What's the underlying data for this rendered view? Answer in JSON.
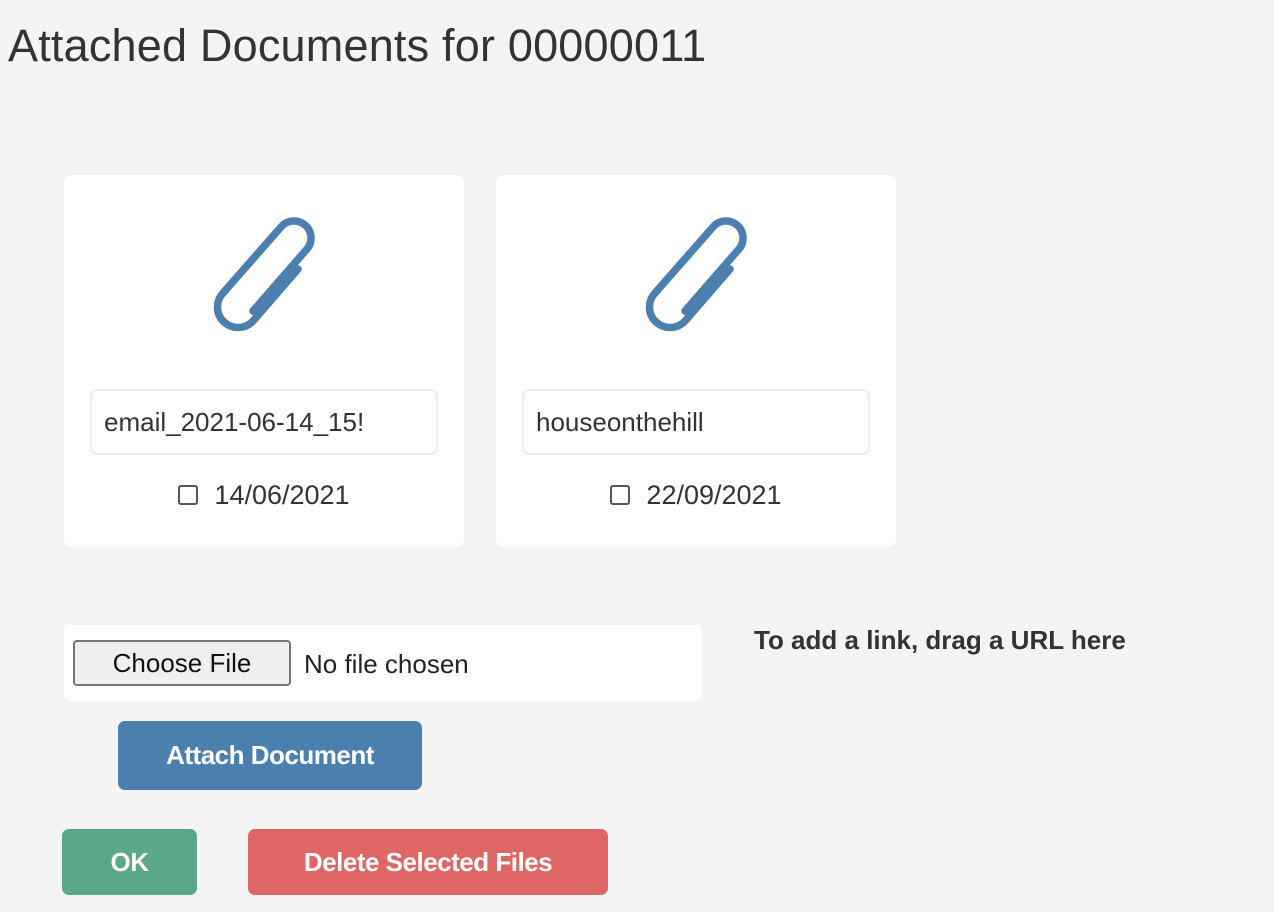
{
  "page": {
    "title": "Attached Documents for 00000011"
  },
  "documents": [
    {
      "filename": "email_2021-06-14_15!",
      "date": "14/06/2021",
      "selected": false,
      "icon": "paperclip-icon"
    },
    {
      "filename": "houseonthehill",
      "date": "22/09/2021",
      "selected": false,
      "icon": "paperclip-icon"
    }
  ],
  "upload": {
    "choose_label": "Choose File",
    "no_file_text": "No file chosen",
    "drag_hint": "To add a link, drag a URL here",
    "attach_label": "Attach Document"
  },
  "actions": {
    "ok_label": "OK",
    "delete_label": "Delete Selected Files"
  },
  "colors": {
    "background": "#f4f4f4",
    "clip_icon": "#4a7fae",
    "attach_button": "#4a7fae",
    "ok_button": "#5ba888",
    "delete_button": "#de6664"
  }
}
